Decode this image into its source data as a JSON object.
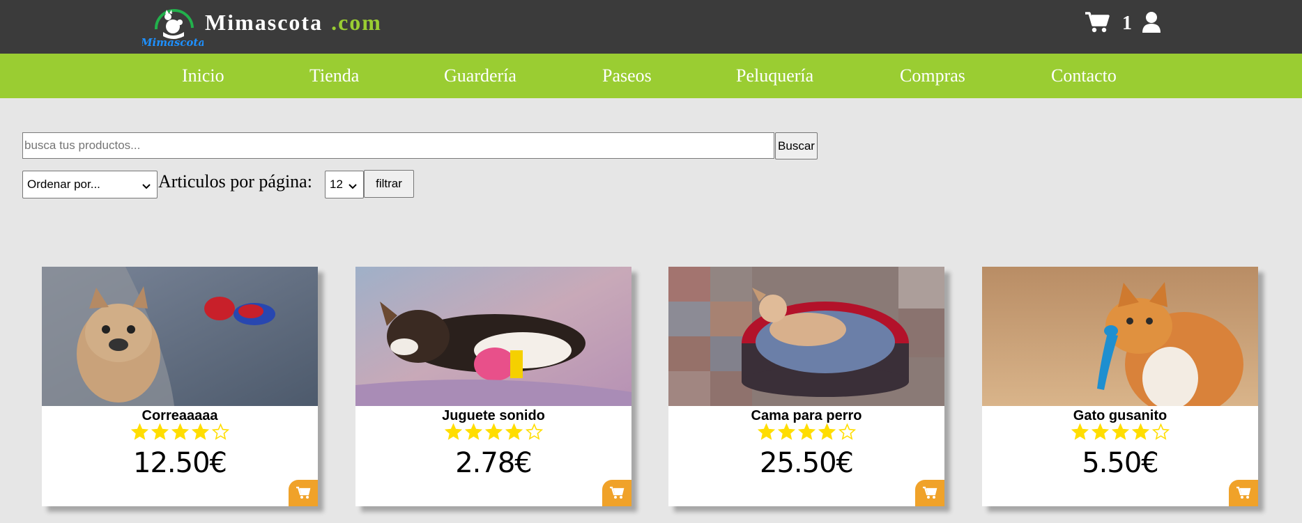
{
  "header": {
    "brand_name": "Mimascota",
    "brand_tld": ".com",
    "logo_text": "Mimascota",
    "cart_count": "1"
  },
  "nav": {
    "items": [
      {
        "label": "Inicio"
      },
      {
        "label": "Tienda"
      },
      {
        "label": "Guardería"
      },
      {
        "label": "Paseos"
      },
      {
        "label": "Peluquería"
      },
      {
        "label": "Compras"
      },
      {
        "label": "Contacto"
      }
    ]
  },
  "search": {
    "placeholder": "busca tus productos...",
    "value": "",
    "button_label": "Buscar"
  },
  "filters": {
    "sort_selected": "Ordenar por...",
    "per_page_label": "Articulos por página:",
    "per_page_selected": "12",
    "filter_button": "filtrar"
  },
  "products": [
    {
      "name": "Correaaaaa",
      "rating": 4,
      "max_rating": 5,
      "price": "12.50€",
      "image": "french-bulldog-with-spiderman-toy"
    },
    {
      "name": "Juguete sonido",
      "rating": 4,
      "max_rating": 5,
      "price": "2.78€",
      "image": "puppy-sleeping-with-toy"
    },
    {
      "name": "Cama para perro",
      "rating": 4,
      "max_rating": 5,
      "price": "25.50€",
      "image": "dog-in-round-bed"
    },
    {
      "name": "Gato gusanito",
      "rating": 4,
      "max_rating": 5,
      "price": "5.50€",
      "image": "cat-with-worm-toy"
    }
  ],
  "colors": {
    "header_bg": "#3b3b3b",
    "nav_bg": "#9acd32",
    "accent_green": "#9acd32",
    "page_bg": "#e6e6e6",
    "star": "#ffdd00",
    "cart_button": "#f0a229"
  }
}
